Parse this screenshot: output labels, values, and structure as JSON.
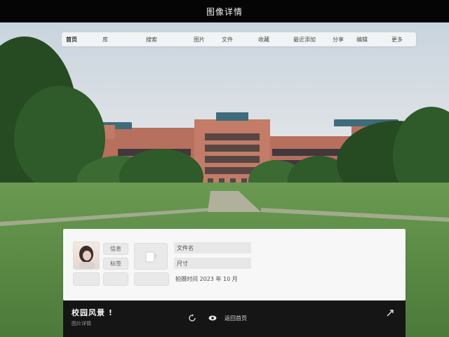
{
  "window": {
    "title": "图像详情"
  },
  "nav": {
    "items": [
      {
        "label": "首页"
      },
      {
        "label": "库"
      },
      {
        "label": "搜索"
      },
      {
        "label": "图片"
      },
      {
        "label": "文件"
      },
      {
        "label": "收藏"
      },
      {
        "label": "最近添加"
      },
      {
        "label": "分享"
      },
      {
        "label": "编辑"
      },
      {
        "label": "更多"
      }
    ]
  },
  "card": {
    "pills": {
      "top_left": "信息",
      "mid_left": "标签",
      "bottom_left": "",
      "bottom_mid": ""
    },
    "info": {
      "line1": "文件名",
      "line2": "尺寸"
    },
    "description": "拍摄时间 2023 年 10 月"
  },
  "bottom": {
    "title": "校园风景 !",
    "subtitle": "图片详情",
    "mid_label": "返回首页"
  },
  "icons": {
    "bottom_left": "refresh-icon",
    "bottom_mid": "eye-icon",
    "bottom_right": "share-icon"
  }
}
